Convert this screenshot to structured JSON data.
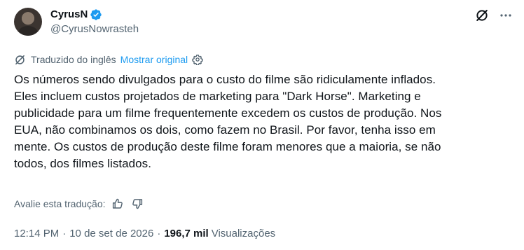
{
  "author": {
    "display_name": "CyrusN",
    "handle": "@CyrusNowrasteh",
    "verified": true
  },
  "translation": {
    "label": "Traduzido do inglês",
    "show_original": "Mostrar original"
  },
  "tweet": {
    "lines": [
      "Os números sendo divulgados para o custo do filme são ridiculamente inflados.",
      "Eles incluem custos projetados de marketing para \"Dark Horse\". Marketing e",
      "publicidade para um filme frequentemente excedem os custos de produção. Nos",
      "EUA, não combinamos os dois, como fazem no Brasil. Por favor, tenha isso em",
      "mente. Os custos de produção deste filme foram menores que a maioria, se não",
      "todos, dos filmes listados."
    ]
  },
  "rating": {
    "label": "Avalie esta tradução:"
  },
  "meta": {
    "time": "12:14 PM",
    "separator": "·",
    "date": "10 de set de 2026",
    "views_count": "196,7 mil",
    "views_label": "Visualizações"
  },
  "colors": {
    "text": "#0f1419",
    "secondary": "#536471",
    "accent": "#1d9bf0"
  },
  "icons": {
    "verified": "verified-badge-icon",
    "grok": "grok-icon",
    "more": "more-dots-icon",
    "translate": "translate-icon",
    "settings": "gear-icon",
    "thumb_up": "thumb-up-icon",
    "thumb_down": "thumb-down-icon"
  }
}
